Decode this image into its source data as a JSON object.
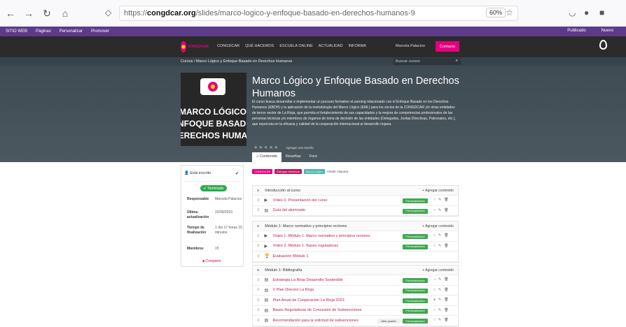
{
  "browser": {
    "url_prefix": "https://",
    "url_domain": "congdcar.org",
    "url_path": "/slides/marco-logico-y-enfoque-basado-en-derechos-humanos-9",
    "zoom": "60%"
  },
  "adminbar": {
    "site": "SITIO WEB",
    "items": [
      "Páginas",
      "Personalizar",
      "Promover"
    ],
    "published": "Publicado",
    "new": "Nuevo"
  },
  "header": {
    "nav": [
      "CONGDCAR",
      "QUÉ HACEMOS",
      "ESCUELA ONLINE",
      "ACTUALIDAD",
      "INFORMA"
    ],
    "user": "Marcela Palacios",
    "contact": "Contacto"
  },
  "breadcrumb": "Cursos  /  Marco Lógico y Enfoque Basado en Derechos Humanos",
  "search_placeholder": "Buscar cursos",
  "cover_text": [
    "MARCO LÓGICO",
    "ENFOQUE BASADO",
    "DERECHOS HUMAN"
  ],
  "course": {
    "title": "Marco Lógico y Enfoque Basado en Derechos Humanos",
    "description": "El curso busca desarrollar e implementar un proceso formativo eLearning relacionado con el Enfoque Basado en los Derechos Humanos (EBDH) y la aplicación de la metodología del Marco Lógico (EML) para los socios de la CONGDCAR y/o otras entidades de tercer sector de La Rioja, que permita el fortalecimiento de sus capacidades y la mejora de competencias profesionales de las personas técnicas y/o miembros de órganos de toma de decisión de las entidades (Delegados, Juntas Directivas, Patronatos, etc.), que repercuta en la eficacia y calidad de la cooperación internacional al desarrollo riojana.",
    "rating_label": "Agregar una reseña",
    "tabs": [
      "Contenido",
      "Reseñas",
      "Foro"
    ]
  },
  "sidebar": {
    "enrolled": "Está inscrito",
    "status": "Terminado",
    "responsible_label": "Responsable",
    "responsible": "Marcela Palacios",
    "updated_label": "Última actualización",
    "updated": "22/09/2023",
    "time_label": "Tiempo de finalización",
    "time": "1 día 17 horas 15 minutos",
    "members_label": "Miembros",
    "members": "15",
    "share": "Compartir"
  },
  "tags": [
    {
      "label": "CONGDCAR",
      "color": "#e5007d"
    },
    {
      "label": "Enfoque derechos",
      "color": "#c2185b"
    },
    {
      "label": "Marco Lógico",
      "color": "#4db6ac"
    }
  ],
  "add_tag": "Añadir etiqueta",
  "add_content": "Agregar contenido",
  "preview_label": "Previsualización",
  "free_preview": "Abrir prueba",
  "modules": [
    {
      "title": "Introducción al curso",
      "items": [
        {
          "icon": "▶",
          "label": "Vídeo 0. Presentación del curso"
        },
        {
          "icon": "▤",
          "label": "Guía del alumnado"
        }
      ]
    },
    {
      "title": "Módulo 1: Marco normativo y principios rectores",
      "items": [
        {
          "icon": "▶",
          "label": "Vídeo 1. Módulo 1. Marco normativo y principios rectores"
        },
        {
          "icon": "▶",
          "label": "Vídeo 2. Módulo 1. Bases reguladoras"
        },
        {
          "icon": "🏆",
          "label": "Evaluación Módulo 1"
        }
      ]
    },
    {
      "title": "Módulo 1: Bibliografía",
      "items": [
        {
          "icon": "▤",
          "label": "Estrategia La Rioja Desarrollo Sostenible"
        },
        {
          "icon": "▤",
          "label": "V Plan Director La Rioja"
        },
        {
          "icon": "▤",
          "label": "Plan Anual de Cooperación La Rioja 2023"
        },
        {
          "icon": "▤",
          "label": "Bases Reguladoras de Concesión de Subvenciones"
        },
        {
          "icon": "▤",
          "label": "Recomendación para la solicitud de subvenciones"
        }
      ]
    }
  ]
}
